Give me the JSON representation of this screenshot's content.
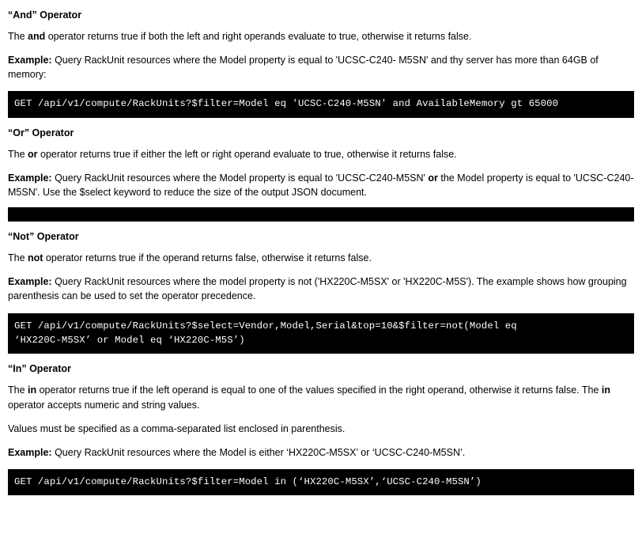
{
  "document": {
    "sections": [
      {
        "title": "“And” Operator",
        "definition_prefix": "The ",
        "definition_keyword": "and",
        "definition_suffix": " operator returns true if both the left and right operands evaluate to true, otherwise it returns false.",
        "example_label": "Example:",
        "example_text": " Query RackUnit resources where the Model property is equal to 'UCSC-C240- M5SN' and thy server has more than 64GB of memory:",
        "code": "GET /api/v1/compute/RackUnits?$filter=Model eq 'UCSC-C240-M5SN' and AvailableMemory gt 65000"
      },
      {
        "title": "“Or” Operator",
        "definition_prefix": "The ",
        "definition_keyword": "or",
        "definition_suffix": " operator returns true if either the left or right operand evaluate to true, otherwise it returns false.",
        "example_label": "Example:",
        "example_text_part1": " Query RackUnit resources where the Model property is equal to 'UCSC-C240-M5SN' ",
        "example_keyword": "or",
        "example_text_part2": " the Model property is equal to 'UCSC-C240-M5SN'. Use the $select keyword to reduce the size of the output JSON document.",
        "code": ""
      },
      {
        "title": "“Not” Operator",
        "definition_prefix": "The ",
        "definition_keyword": "not",
        "definition_suffix": " operator returns true if the operand returns false, otherwise it returns false.",
        "example_label": "Example:",
        "example_text": " Query RackUnit resources where the model property is not ('HX220C-M5SX' or 'HX220C-M5S'). The example shows how grouping parenthesis can be used to set the operator precedence.",
        "code": "GET /api/v1/compute/RackUnits?$select=Vendor,Model,Serial&top=10&$filter=not(Model eq\n‘HX220C-M5SX’ or Model eq ‘HX220C-M5S’)"
      },
      {
        "title": "“In” Operator",
        "definition_prefix": "The ",
        "definition_keyword": "in",
        "definition_suffix": " operator returns true if the left operand is equal to one of the values specified in the right operand, otherwise it returns false. The ",
        "definition_keyword2": "in",
        "definition_suffix2": " operator accepts numeric and string values.",
        "note": "Values must be specified as a comma-separated list enclosed in parenthesis.",
        "example_label": "Example:",
        "example_text": " Query RackUnit resources where the Model is either ‘HX220C-M5SX’ or ‘UCSC-C240-M5SN’.",
        "code": "GET /api/v1/compute/RackUnits?$filter=Model in (‘HX220C-M5SX’,‘UCSC-C240-M5SN’)"
      }
    ]
  }
}
